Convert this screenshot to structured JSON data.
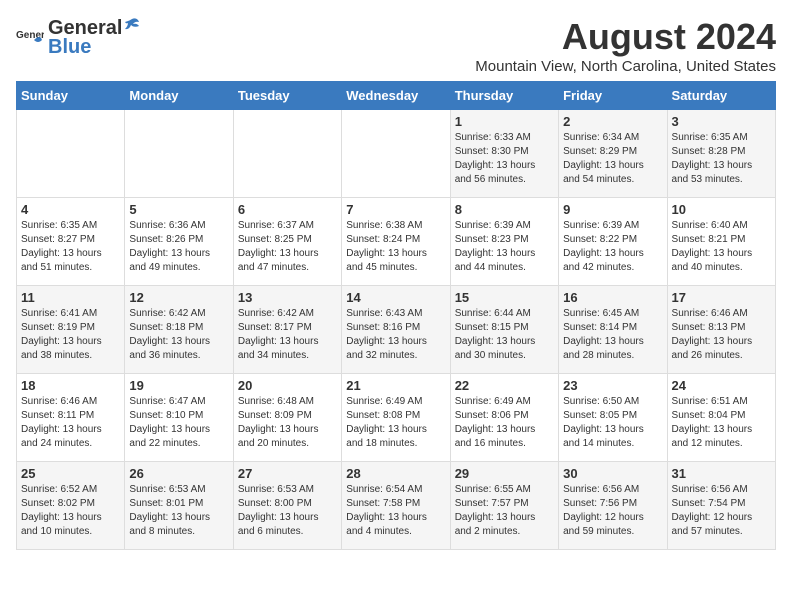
{
  "logo": {
    "general": "General",
    "blue": "Blue"
  },
  "title": "August 2024",
  "subtitle": "Mountain View, North Carolina, United States",
  "days_of_week": [
    "Sunday",
    "Monday",
    "Tuesday",
    "Wednesday",
    "Thursday",
    "Friday",
    "Saturday"
  ],
  "weeks": [
    [
      {
        "day": "",
        "sunrise": "",
        "sunset": "",
        "daylight": ""
      },
      {
        "day": "",
        "sunrise": "",
        "sunset": "",
        "daylight": ""
      },
      {
        "day": "",
        "sunrise": "",
        "sunset": "",
        "daylight": ""
      },
      {
        "day": "",
        "sunrise": "",
        "sunset": "",
        "daylight": ""
      },
      {
        "day": "1",
        "sunrise": "Sunrise: 6:33 AM",
        "sunset": "Sunset: 8:30 PM",
        "daylight": "Daylight: 13 hours and 56 minutes."
      },
      {
        "day": "2",
        "sunrise": "Sunrise: 6:34 AM",
        "sunset": "Sunset: 8:29 PM",
        "daylight": "Daylight: 13 hours and 54 minutes."
      },
      {
        "day": "3",
        "sunrise": "Sunrise: 6:35 AM",
        "sunset": "Sunset: 8:28 PM",
        "daylight": "Daylight: 13 hours and 53 minutes."
      }
    ],
    [
      {
        "day": "4",
        "sunrise": "Sunrise: 6:35 AM",
        "sunset": "Sunset: 8:27 PM",
        "daylight": "Daylight: 13 hours and 51 minutes."
      },
      {
        "day": "5",
        "sunrise": "Sunrise: 6:36 AM",
        "sunset": "Sunset: 8:26 PM",
        "daylight": "Daylight: 13 hours and 49 minutes."
      },
      {
        "day": "6",
        "sunrise": "Sunrise: 6:37 AM",
        "sunset": "Sunset: 8:25 PM",
        "daylight": "Daylight: 13 hours and 47 minutes."
      },
      {
        "day": "7",
        "sunrise": "Sunrise: 6:38 AM",
        "sunset": "Sunset: 8:24 PM",
        "daylight": "Daylight: 13 hours and 45 minutes."
      },
      {
        "day": "8",
        "sunrise": "Sunrise: 6:39 AM",
        "sunset": "Sunset: 8:23 PM",
        "daylight": "Daylight: 13 hours and 44 minutes."
      },
      {
        "day": "9",
        "sunrise": "Sunrise: 6:39 AM",
        "sunset": "Sunset: 8:22 PM",
        "daylight": "Daylight: 13 hours and 42 minutes."
      },
      {
        "day": "10",
        "sunrise": "Sunrise: 6:40 AM",
        "sunset": "Sunset: 8:21 PM",
        "daylight": "Daylight: 13 hours and 40 minutes."
      }
    ],
    [
      {
        "day": "11",
        "sunrise": "Sunrise: 6:41 AM",
        "sunset": "Sunset: 8:19 PM",
        "daylight": "Daylight: 13 hours and 38 minutes."
      },
      {
        "day": "12",
        "sunrise": "Sunrise: 6:42 AM",
        "sunset": "Sunset: 8:18 PM",
        "daylight": "Daylight: 13 hours and 36 minutes."
      },
      {
        "day": "13",
        "sunrise": "Sunrise: 6:42 AM",
        "sunset": "Sunset: 8:17 PM",
        "daylight": "Daylight: 13 hours and 34 minutes."
      },
      {
        "day": "14",
        "sunrise": "Sunrise: 6:43 AM",
        "sunset": "Sunset: 8:16 PM",
        "daylight": "Daylight: 13 hours and 32 minutes."
      },
      {
        "day": "15",
        "sunrise": "Sunrise: 6:44 AM",
        "sunset": "Sunset: 8:15 PM",
        "daylight": "Daylight: 13 hours and 30 minutes."
      },
      {
        "day": "16",
        "sunrise": "Sunrise: 6:45 AM",
        "sunset": "Sunset: 8:14 PM",
        "daylight": "Daylight: 13 hours and 28 minutes."
      },
      {
        "day": "17",
        "sunrise": "Sunrise: 6:46 AM",
        "sunset": "Sunset: 8:13 PM",
        "daylight": "Daylight: 13 hours and 26 minutes."
      }
    ],
    [
      {
        "day": "18",
        "sunrise": "Sunrise: 6:46 AM",
        "sunset": "Sunset: 8:11 PM",
        "daylight": "Daylight: 13 hours and 24 minutes."
      },
      {
        "day": "19",
        "sunrise": "Sunrise: 6:47 AM",
        "sunset": "Sunset: 8:10 PM",
        "daylight": "Daylight: 13 hours and 22 minutes."
      },
      {
        "day": "20",
        "sunrise": "Sunrise: 6:48 AM",
        "sunset": "Sunset: 8:09 PM",
        "daylight": "Daylight: 13 hours and 20 minutes."
      },
      {
        "day": "21",
        "sunrise": "Sunrise: 6:49 AM",
        "sunset": "Sunset: 8:08 PM",
        "daylight": "Daylight: 13 hours and 18 minutes."
      },
      {
        "day": "22",
        "sunrise": "Sunrise: 6:49 AM",
        "sunset": "Sunset: 8:06 PM",
        "daylight": "Daylight: 13 hours and 16 minutes."
      },
      {
        "day": "23",
        "sunrise": "Sunrise: 6:50 AM",
        "sunset": "Sunset: 8:05 PM",
        "daylight": "Daylight: 13 hours and 14 minutes."
      },
      {
        "day": "24",
        "sunrise": "Sunrise: 6:51 AM",
        "sunset": "Sunset: 8:04 PM",
        "daylight": "Daylight: 13 hours and 12 minutes."
      }
    ],
    [
      {
        "day": "25",
        "sunrise": "Sunrise: 6:52 AM",
        "sunset": "Sunset: 8:02 PM",
        "daylight": "Daylight: 13 hours and 10 minutes."
      },
      {
        "day": "26",
        "sunrise": "Sunrise: 6:53 AM",
        "sunset": "Sunset: 8:01 PM",
        "daylight": "Daylight: 13 hours and 8 minutes."
      },
      {
        "day": "27",
        "sunrise": "Sunrise: 6:53 AM",
        "sunset": "Sunset: 8:00 PM",
        "daylight": "Daylight: 13 hours and 6 minutes."
      },
      {
        "day": "28",
        "sunrise": "Sunrise: 6:54 AM",
        "sunset": "Sunset: 7:58 PM",
        "daylight": "Daylight: 13 hours and 4 minutes."
      },
      {
        "day": "29",
        "sunrise": "Sunrise: 6:55 AM",
        "sunset": "Sunset: 7:57 PM",
        "daylight": "Daylight: 13 hours and 2 minutes."
      },
      {
        "day": "30",
        "sunrise": "Sunrise: 6:56 AM",
        "sunset": "Sunset: 7:56 PM",
        "daylight": "Daylight: 12 hours and 59 minutes."
      },
      {
        "day": "31",
        "sunrise": "Sunrise: 6:56 AM",
        "sunset": "Sunset: 7:54 PM",
        "daylight": "Daylight: 12 hours and 57 minutes."
      }
    ]
  ]
}
